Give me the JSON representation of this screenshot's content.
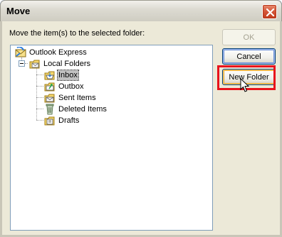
{
  "window": {
    "title": "Move"
  },
  "prompt": "Move the item(s) to the selected folder:",
  "tree": {
    "root": {
      "label": "Outlook Express",
      "icon": "outlook-express-icon"
    },
    "local": {
      "label": "Local Folders",
      "icon": "local-folders-icon"
    },
    "folders": [
      {
        "label": "Inbox",
        "icon": "inbox-folder-icon",
        "selected": true
      },
      {
        "label": "Outbox",
        "icon": "outbox-folder-icon"
      },
      {
        "label": "Sent Items",
        "icon": "sent-items-folder-icon"
      },
      {
        "label": "Deleted Items",
        "icon": "deleted-items-folder-icon"
      },
      {
        "label": "Drafts",
        "icon": "drafts-folder-icon"
      }
    ]
  },
  "buttons": {
    "ok": "OK",
    "cancel": "Cancel",
    "new_folder": "New Folder"
  },
  "colors": {
    "highlight_border": "#e8121c",
    "dialog_face": "#ece9d8",
    "tree_border": "#7f9db9"
  }
}
